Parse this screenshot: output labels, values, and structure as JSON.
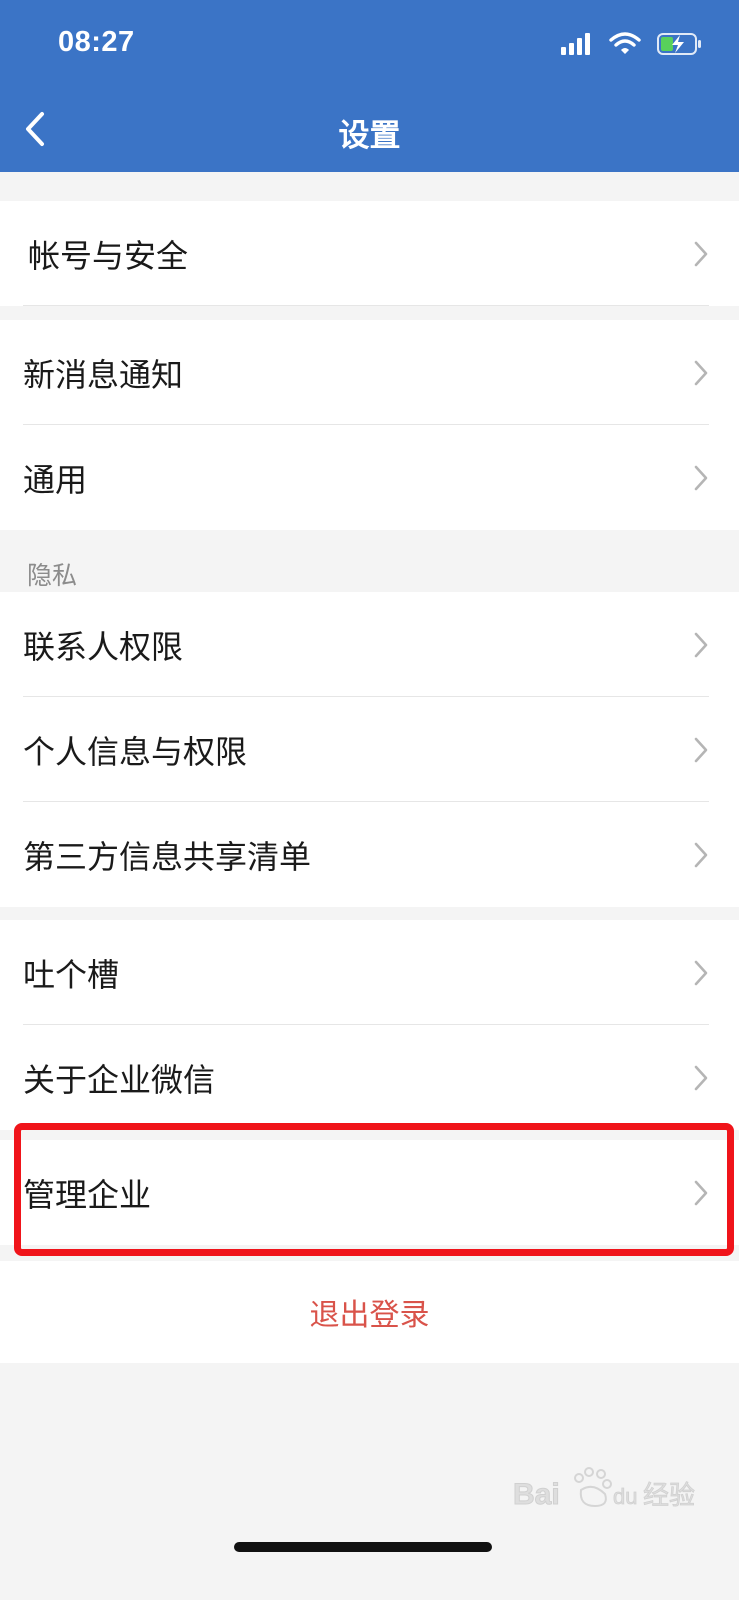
{
  "status_bar": {
    "time": "08:27",
    "icons": [
      "signal-icon",
      "wifi-icon",
      "battery-charging-icon"
    ]
  },
  "header": {
    "title": "设置",
    "back_icon": "chevron-left-icon",
    "background_color": "#3b74c6"
  },
  "groups": {
    "account": [
      {
        "label": "帐号与安全"
      }
    ],
    "general": [
      {
        "label": "新消息通知"
      },
      {
        "label": "通用"
      }
    ],
    "privacy_section_label": "隐私",
    "privacy": [
      {
        "label": "联系人权限"
      },
      {
        "label": "个人信息与权限"
      },
      {
        "label": "第三方信息共享清单"
      }
    ],
    "about": [
      {
        "label": "吐个槽"
      },
      {
        "label": "关于企业微信"
      }
    ],
    "manage": [
      {
        "label": "管理企业"
      }
    ]
  },
  "logout": {
    "label": "退出登录",
    "color": "#d9534a"
  },
  "watermark": {
    "text": "Baidu 经验"
  },
  "highlight_color": "#f0141a"
}
